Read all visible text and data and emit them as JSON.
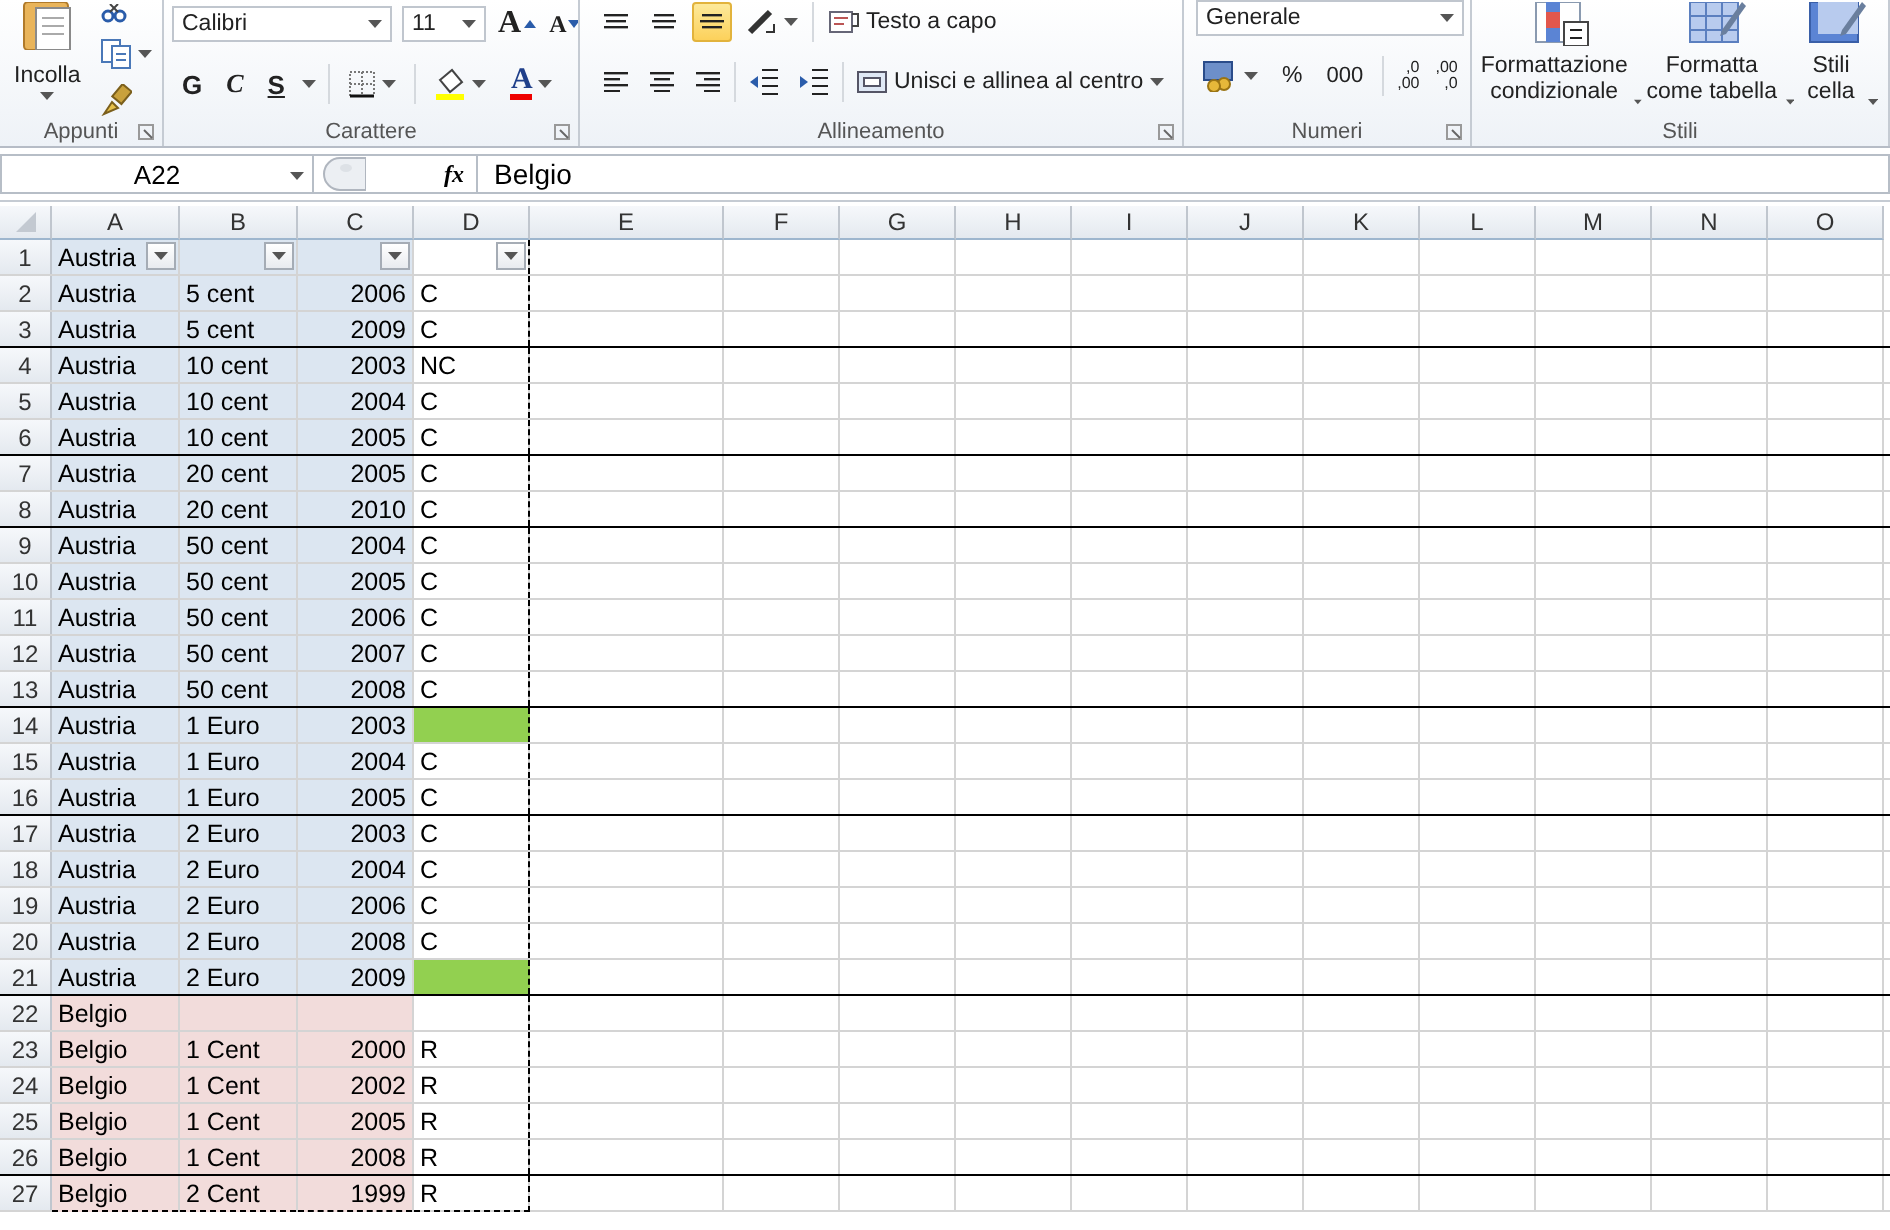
{
  "ribbon": {
    "groups": [
      {
        "kind": "clipboard",
        "label": "Appunti",
        "launcher": true,
        "paste_label": "Incolla"
      },
      {
        "kind": "font",
        "label": "Carattere",
        "launcher": true,
        "font": "Calibri",
        "size": "11",
        "grow": "A",
        "shrink": "A",
        "bold": "G",
        "italic": "C",
        "underline": "S",
        "font_color": "A"
      },
      {
        "kind": "alignment",
        "label": "Allineamento",
        "launcher": true,
        "vertical": [
          {
            "selected": false
          },
          {
            "selected": false
          },
          {
            "selected": true
          }
        ],
        "wrap_text": "Testo a capo",
        "merge": "Unisci e allinea al centro"
      },
      {
        "kind": "number",
        "label": "Numeri",
        "launcher": true,
        "format": "Generale",
        "percent": "%",
        "thousands": "000",
        "decimals": [
          {
            "top": ",0",
            "bottom": ",00"
          },
          {
            "top": ",00",
            "bottom": ",0"
          }
        ]
      },
      {
        "kind": "styles",
        "label": "Stili",
        "launcher": false,
        "buttons": [
          {
            "label": "Formattazione condizionale"
          },
          {
            "label": "Formatta come tabella"
          },
          {
            "label": "Stili cella"
          }
        ]
      }
    ]
  },
  "formula_bar": {
    "name_box": "A22",
    "fx": "fx",
    "value": "Belgio"
  },
  "sheet": {
    "autofilter": true,
    "columns": [
      {
        "label": "A",
        "kind": "text"
      },
      {
        "label": "B",
        "kind": "text"
      },
      {
        "label": "C",
        "kind": "number"
      },
      {
        "label": "D",
        "kind": "text",
        "marquee_right": true
      },
      {
        "label": "E"
      },
      {
        "label": "F"
      },
      {
        "label": "G"
      },
      {
        "label": "H"
      },
      {
        "label": "I"
      },
      {
        "label": "J"
      },
      {
        "label": "K"
      },
      {
        "label": "L"
      },
      {
        "label": "M"
      },
      {
        "label": "N"
      },
      {
        "label": "O"
      }
    ],
    "rows": [
      {
        "num": "1",
        "a": "Austria",
        "color": "#dce6f1",
        "highlight": false,
        "border_below": false
      },
      {
        "num": "2",
        "a": "Austria",
        "b": "5 cent",
        "c": "2006",
        "d": "C",
        "color": "#dce6f1",
        "highlight": false,
        "border_below": false
      },
      {
        "num": "3",
        "a": "Austria",
        "b": "5 cent",
        "c": "2009",
        "d": "C",
        "color": "#dce6f1",
        "highlight": false,
        "border_below": true
      },
      {
        "num": "4",
        "a": "Austria",
        "b": "10 cent",
        "c": "2003",
        "d": "NC",
        "color": "#dce6f1",
        "highlight": false,
        "border_below": false
      },
      {
        "num": "5",
        "a": "Austria",
        "b": "10 cent",
        "c": "2004",
        "d": "C",
        "color": "#dce6f1",
        "highlight": false,
        "border_below": false
      },
      {
        "num": "6",
        "a": "Austria",
        "b": "10 cent",
        "c": "2005",
        "d": "C",
        "color": "#dce6f1",
        "highlight": false,
        "border_below": true
      },
      {
        "num": "7",
        "a": "Austria",
        "b": "20 cent",
        "c": "2005",
        "d": "C",
        "color": "#dce6f1",
        "highlight": false,
        "border_below": false
      },
      {
        "num": "8",
        "a": "Austria",
        "b": "20 cent",
        "c": "2010",
        "d": "C",
        "color": "#dce6f1",
        "highlight": false,
        "border_below": true
      },
      {
        "num": "9",
        "a": "Austria",
        "b": "50 cent",
        "c": "2004",
        "d": "C",
        "color": "#dce6f1",
        "highlight": false,
        "border_below": false
      },
      {
        "num": "10",
        "a": "Austria",
        "b": "50 cent",
        "c": "2005",
        "d": "C",
        "color": "#dce6f1",
        "highlight": false,
        "border_below": false
      },
      {
        "num": "11",
        "a": "Austria",
        "b": "50 cent",
        "c": "2006",
        "d": "C",
        "color": "#dce6f1",
        "highlight": false,
        "border_below": false
      },
      {
        "num": "12",
        "a": "Austria",
        "b": "50 cent",
        "c": "2007",
        "d": "C",
        "color": "#dce6f1",
        "highlight": false,
        "border_below": false
      },
      {
        "num": "13",
        "a": "Austria",
        "b": "50 cent",
        "c": "2008",
        "d": "C",
        "color": "#dce6f1",
        "highlight": false,
        "border_below": true
      },
      {
        "num": "14",
        "a": "Austria",
        "b": "1 Euro",
        "c": "2003",
        "color": "#dce6f1",
        "highlight": true,
        "border_below": false
      },
      {
        "num": "15",
        "a": "Austria",
        "b": "1 Euro",
        "c": "2004",
        "d": "C",
        "color": "#dce6f1",
        "highlight": false,
        "border_below": false
      },
      {
        "num": "16",
        "a": "Austria",
        "b": "1 Euro",
        "c": "2005",
        "d": "C",
        "color": "#dce6f1",
        "highlight": false,
        "border_below": true
      },
      {
        "num": "17",
        "a": "Austria",
        "b": "2 Euro",
        "c": "2003",
        "d": "C",
        "color": "#dce6f1",
        "highlight": false,
        "border_below": false
      },
      {
        "num": "18",
        "a": "Austria",
        "b": "2 Euro",
        "c": "2004",
        "d": "C",
        "color": "#dce6f1",
        "highlight": false,
        "border_below": false
      },
      {
        "num": "19",
        "a": "Austria",
        "b": "2 Euro",
        "c": "2006",
        "d": "C",
        "color": "#dce6f1",
        "highlight": false,
        "border_below": false
      },
      {
        "num": "20",
        "a": "Austria",
        "b": "2 Euro",
        "c": "2008",
        "d": "C",
        "color": "#dce6f1",
        "highlight": false,
        "border_below": false
      },
      {
        "num": "21",
        "a": "Austria",
        "b": "2 Euro",
        "c": "2009",
        "color": "#dce6f1",
        "highlight": true,
        "border_below": true
      },
      {
        "num": "22",
        "a": "Belgio",
        "color": "#f2dcdb",
        "highlight": false,
        "border_below": false
      },
      {
        "num": "23",
        "a": "Belgio",
        "b": "1 Cent",
        "c": "2000",
        "d": "R",
        "color": "#f2dcdb",
        "highlight": false,
        "border_below": false
      },
      {
        "num": "24",
        "a": "Belgio",
        "b": "1 Cent",
        "c": "2002",
        "d": "R",
        "color": "#f2dcdb",
        "highlight": false,
        "border_below": false
      },
      {
        "num": "25",
        "a": "Belgio",
        "b": "1 Cent",
        "c": "2005",
        "d": "R",
        "color": "#f2dcdb",
        "highlight": false,
        "border_below": false
      },
      {
        "num": "26",
        "a": "Belgio",
        "b": "1 Cent",
        "c": "2008",
        "d": "R",
        "color": "#f2dcdb",
        "highlight": false,
        "border_below": true
      },
      {
        "num": "27",
        "a": "Belgio",
        "b": "2 Cent",
        "c": "1999",
        "d": "R",
        "color": "#f2dcdb",
        "highlight": false,
        "border_below": false,
        "marquee_below": true
      }
    ]
  }
}
